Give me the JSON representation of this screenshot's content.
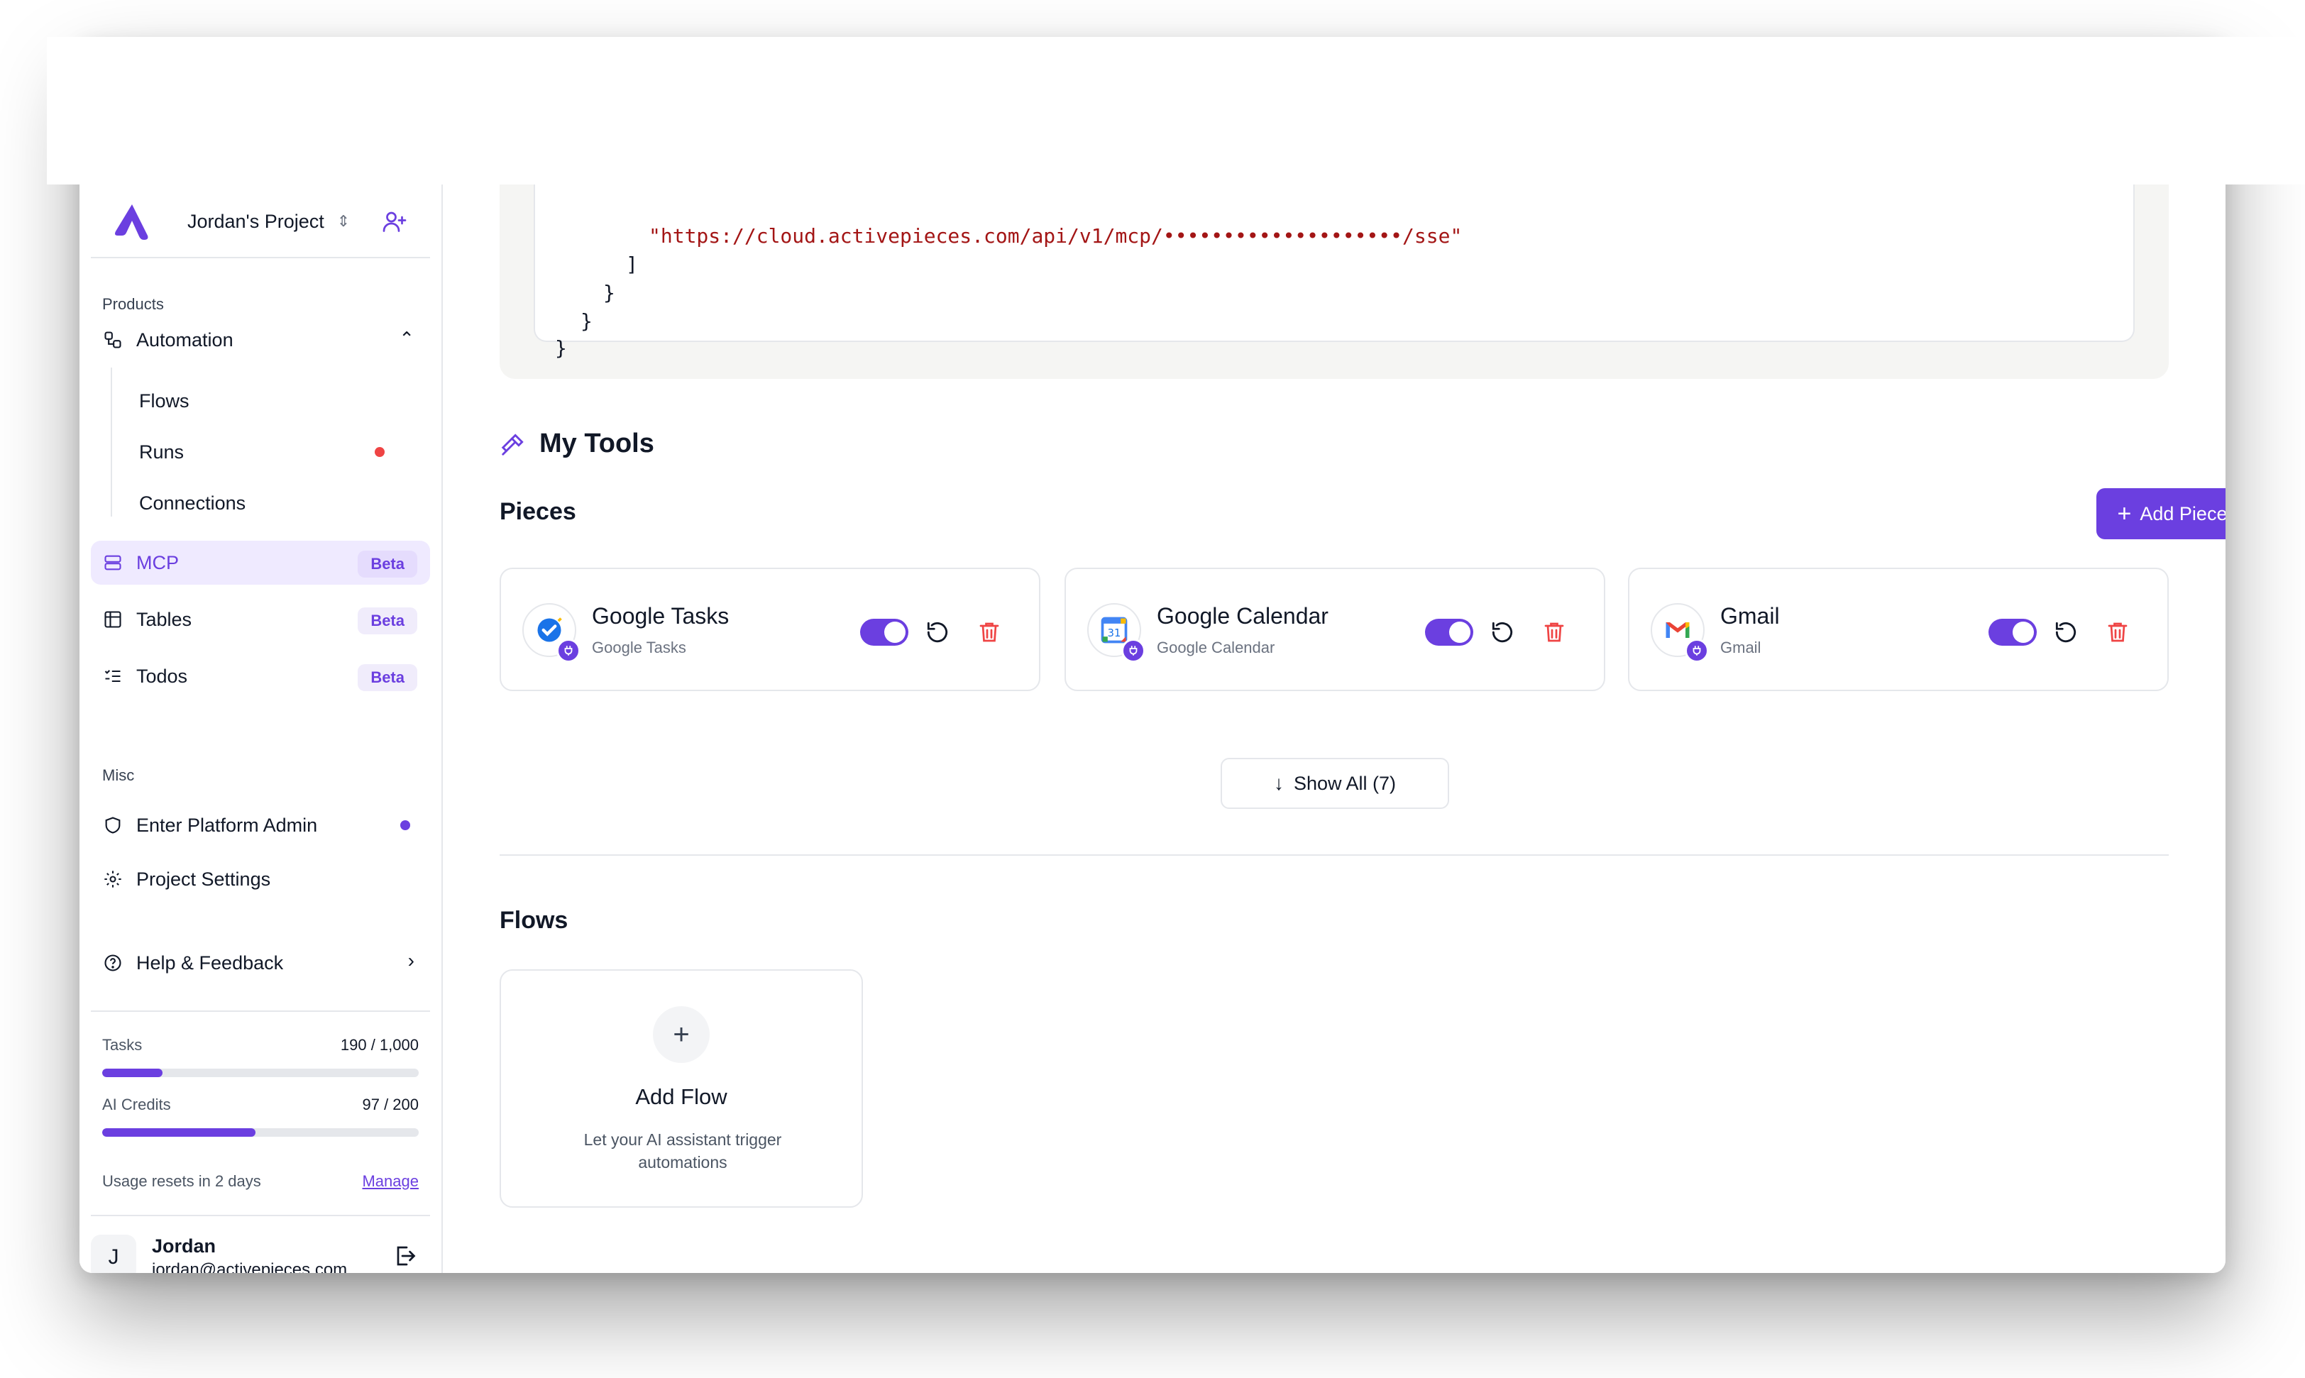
{
  "project": {
    "name": "Jordan's Project"
  },
  "sidebar": {
    "products_label": "Products",
    "automation": {
      "label": "Automation",
      "children": [
        "Flows",
        "Runs",
        "Connections"
      ]
    },
    "mcp": {
      "label": "MCP",
      "badge": "Beta"
    },
    "tables": {
      "label": "Tables",
      "badge": "Beta"
    },
    "todos": {
      "label": "Todos",
      "badge": "Beta"
    },
    "misc_label": "Misc",
    "platform_admin": "Enter Platform Admin",
    "project_settings": "Project Settings",
    "help": "Help & Feedback",
    "usage": {
      "tasks_label": "Tasks",
      "tasks_value": "190 / 1,000",
      "tasks_fraction": 0.19,
      "ai_label": "AI Credits",
      "ai_value": "97 / 200",
      "ai_fraction": 0.485,
      "resets": "Usage resets in 2 days",
      "manage": "Manage"
    },
    "user": {
      "initial": "J",
      "name": "Jordan",
      "email": "jordan@activepieces.com"
    }
  },
  "code": {
    "url_line": "\"https://cloud.activepieces.com/api/v1/mcp/••••••••••••••••••••/sse\"",
    "line2": "]",
    "line3": "}",
    "line4": "}",
    "line5": "}"
  },
  "tools": {
    "title": "My Tools",
    "pieces_title": "Pieces",
    "add_piece": "Add Piece",
    "pieces": [
      {
        "title": "Google Tasks",
        "subtitle": "Google Tasks",
        "icon": "google-tasks-icon",
        "enabled": true
      },
      {
        "title": "Google Calendar",
        "subtitle": "Google Calendar",
        "icon": "google-calendar-icon",
        "enabled": true
      },
      {
        "title": "Gmail",
        "subtitle": "Gmail",
        "icon": "gmail-icon",
        "enabled": true
      }
    ],
    "show_all": "Show All (7)"
  },
  "flows": {
    "title": "Flows",
    "add_flow": "Add Flow",
    "add_flow_desc": "Let your AI assistant trigger automations"
  },
  "colors": {
    "accent": "#6b3fe0",
    "runs_dot": "#ef4444",
    "trash": "#ef4444"
  }
}
